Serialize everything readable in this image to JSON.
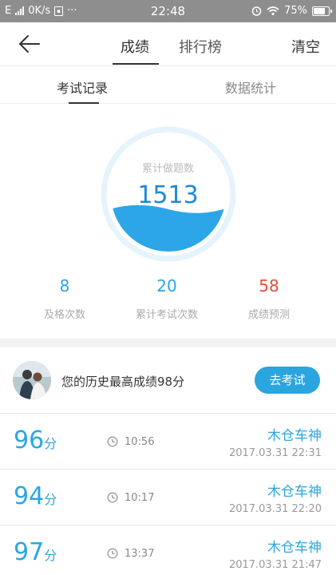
{
  "status_bar": {
    "network": "E",
    "speed": "0K/s",
    "more": "···",
    "time": "22:48",
    "battery_pct": "75%"
  },
  "nav": {
    "tab_active": "成绩",
    "tab_other": "排行榜",
    "clear": "清空"
  },
  "subtabs": {
    "active": "考试记录",
    "other": "数据统计"
  },
  "gauge": {
    "label": "累计做题数",
    "value": "1513",
    "accent": "#2ca6e8"
  },
  "stats": [
    {
      "value": "8",
      "label": "及格次数",
      "color": "#29a7e1"
    },
    {
      "value": "20",
      "label": "累计考试次数",
      "color": "#29a7e1"
    },
    {
      "value": "58",
      "label": "成绩预测",
      "color": "#e84b3c"
    }
  ],
  "history": {
    "text": "您的历史最高成绩98分",
    "button": "去考试"
  },
  "records": [
    {
      "score": "96",
      "unit": "分",
      "duration": "10:56",
      "name": "木仓车神",
      "date": "2017.03.31   22:31"
    },
    {
      "score": "94",
      "unit": "分",
      "duration": "10:17",
      "name": "木仓车神",
      "date": "2017.03.31   22:20"
    },
    {
      "score": "97",
      "unit": "分",
      "duration": "13:37",
      "name": "木仓车神",
      "date": "2017.03.31   21:47"
    }
  ]
}
